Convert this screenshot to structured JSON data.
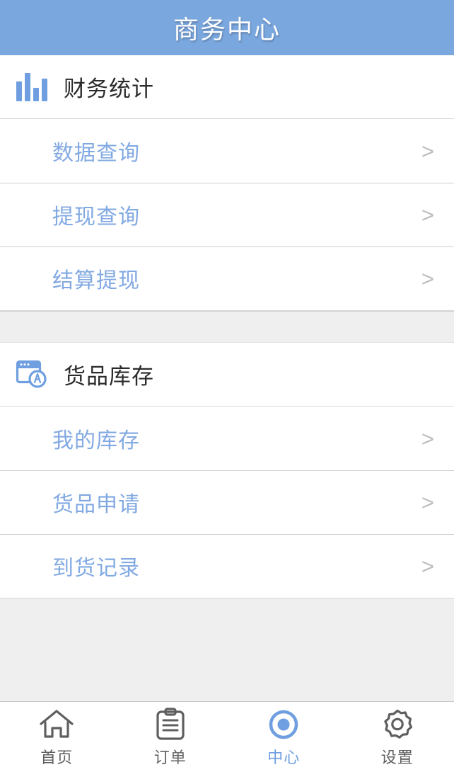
{
  "header": {
    "title": "商务中心",
    "background_color": "#7aa7de",
    "text_color": "#ffffff"
  },
  "theme": {
    "accent_color": "#6f9fe0",
    "link_color": "#82a9e2",
    "page_background": "#efefef",
    "card_background": "#ffffff",
    "divider_color": "#cfcfcf",
    "chevron_color": "#bdbdbd",
    "title_color": "#2b2b2b"
  },
  "sections": [
    {
      "icon": "bar-chart-icon",
      "title": "财务统计",
      "items": [
        {
          "label": "数据查询",
          "chevron": ">"
        },
        {
          "label": "提现查询",
          "chevron": ">"
        },
        {
          "label": "结算提现",
          "chevron": ">"
        }
      ]
    },
    {
      "icon": "browser-window-badge-icon",
      "title": "货品库存",
      "items": [
        {
          "label": "我的库存",
          "chevron": ">"
        },
        {
          "label": "货品申请",
          "chevron": ">"
        },
        {
          "label": "到货记录",
          "chevron": ">"
        }
      ]
    }
  ],
  "tabbar": {
    "tabs": [
      {
        "icon": "home-icon",
        "label": "首页",
        "active": false
      },
      {
        "icon": "clipboard-icon",
        "label": "订单",
        "active": false
      },
      {
        "icon": "target-icon",
        "label": "中心",
        "active": true
      },
      {
        "icon": "gear-icon",
        "label": "设置",
        "active": false
      }
    ]
  }
}
